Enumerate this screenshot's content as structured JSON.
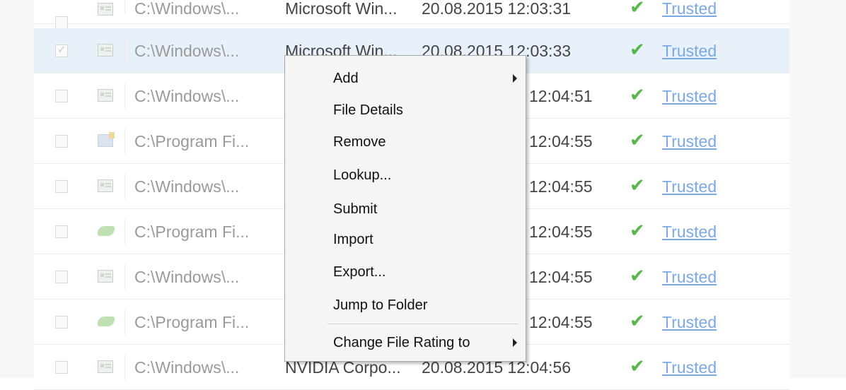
{
  "rows": [
    {
      "checked": false,
      "icon": "window-icon",
      "path": "C:\\Windows\\...",
      "vendor": "Microsoft Win...",
      "date": "20.08.2015 12:03:31",
      "rating": "Trusted"
    },
    {
      "checked": true,
      "icon": "window-icon",
      "path": "C:\\Windows\\...",
      "vendor": "Microsoft Win...",
      "date": "20.08.2015 12:03:33",
      "rating": "Trusted"
    },
    {
      "checked": false,
      "icon": "window-icon",
      "path": "C:\\Windows\\...",
      "vendor": "",
      "date": "12:04:51",
      "rating": "Trusted"
    },
    {
      "checked": false,
      "icon": "installer-icon",
      "path": "C:\\Program Fi...",
      "vendor": "",
      "date": "12:04:55",
      "rating": "Trusted"
    },
    {
      "checked": false,
      "icon": "window-icon",
      "path": "C:\\Windows\\...",
      "vendor": "",
      "date": "12:04:55",
      "rating": "Trusted"
    },
    {
      "checked": false,
      "icon": "nvidia-icon",
      "path": "C:\\Program Fi...",
      "vendor": "",
      "date": "12:04:55",
      "rating": "Trusted"
    },
    {
      "checked": false,
      "icon": "window-icon",
      "path": "C:\\Windows\\...",
      "vendor": "",
      "date": "12:04:55",
      "rating": "Trusted"
    },
    {
      "checked": false,
      "icon": "nvidia-icon",
      "path": "C:\\Program Fi...",
      "vendor": "",
      "date": "12:04:55",
      "rating": "Trusted"
    },
    {
      "checked": false,
      "icon": "window-icon",
      "path": "C:\\Windows\\...",
      "vendor": "NVIDIA Corpo...",
      "date": "20.08.2015 12:04:56",
      "rating": "Trusted"
    }
  ],
  "check_glyph": "✔",
  "context_menu": {
    "add": "Add",
    "file_details": "File Details",
    "remove": "Remove",
    "lookup": "Lookup...",
    "submit": "Submit",
    "import": "Import",
    "export": "Export...",
    "jump_to_folder": "Jump to Folder",
    "change_file_rating": "Change File Rating to"
  },
  "colors": {
    "trusted_link": "#7aa9e4",
    "check_green": "#55b847",
    "selected_row": "#e8f1fa"
  }
}
